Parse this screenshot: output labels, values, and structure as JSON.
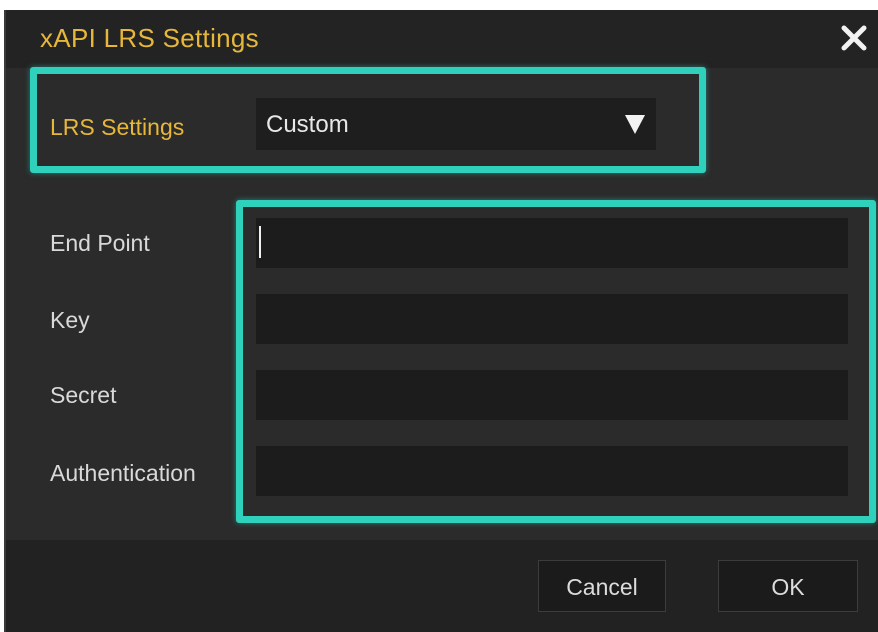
{
  "dialog": {
    "title": "xAPI LRS Settings",
    "close_icon": "close-icon"
  },
  "lrs": {
    "label": "LRS Settings",
    "selected": "Custom",
    "arrow_icon": "triangle-down-icon"
  },
  "fields": {
    "endpoint": {
      "label": "End Point",
      "value": ""
    },
    "key": {
      "label": "Key",
      "value": ""
    },
    "secret": {
      "label": "Secret",
      "value": ""
    },
    "authentication": {
      "label": "Authentication",
      "value": ""
    }
  },
  "buttons": {
    "cancel": "Cancel",
    "ok": "OK"
  },
  "colors": {
    "accent_title": "#e6b739",
    "highlight": "#2fd1bd",
    "dialog_bg": "#2b2b2b",
    "field_bg": "#1c1c1c"
  }
}
